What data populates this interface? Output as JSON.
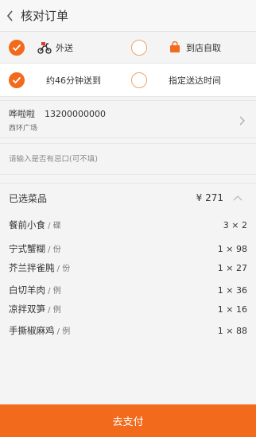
{
  "header": {
    "title": "核对订单"
  },
  "delivery_options": {
    "takeout_label": "外送",
    "pickup_label": "到店自取",
    "selected": "takeout"
  },
  "time_options": {
    "asap_label": "约46分钟送到",
    "scheduled_label": "指定送达时间",
    "selected": "asap"
  },
  "address": {
    "name": "哗啦啦",
    "phone": "13200000000",
    "location": "西环广场"
  },
  "remark": {
    "placeholder": "请输入是否有忌口(可不填)"
  },
  "dishes": {
    "title": "已选菜品",
    "total": "¥ 271",
    "items": [
      {
        "name": "餐前小食",
        "unit": " / 碟",
        "qty": "3 × 2"
      },
      {
        "name": "宁式蟹糊",
        "unit": " / 份",
        "qty": "1 × 98"
      },
      {
        "name": "芥兰拌雀肫",
        "unit": " / 份",
        "qty": "1 × 27"
      },
      {
        "name": "白切羊肉",
        "unit": " / 例",
        "qty": "1 × 36"
      },
      {
        "name": "凉拌双笋",
        "unit": " / 例",
        "qty": "1 × 16"
      },
      {
        "name": "手撕椒麻鸡",
        "unit": " / 例",
        "qty": "1 × 88"
      }
    ]
  },
  "pay_button": {
    "label": "去支付"
  },
  "colors": {
    "accent": "#f26b1d",
    "background": "#f4f4f4"
  }
}
